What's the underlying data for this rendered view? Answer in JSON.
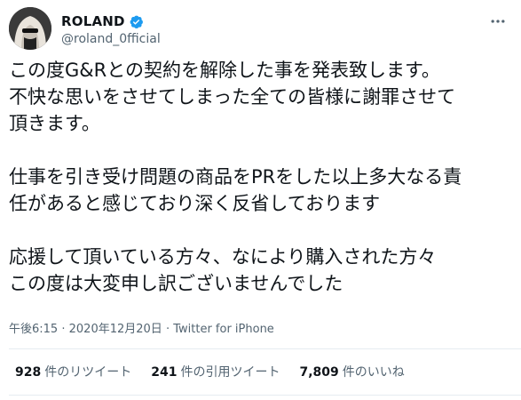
{
  "user": {
    "display_name": "ROLAND",
    "handle": "@roland_0fficial",
    "verified": true
  },
  "tweet": {
    "paragraphs": [
      [
        "この度G&Rとの契約を解除した事を発表致します。",
        "不快な思いをさせてしまった全ての皆様に謝罪させて",
        "頂きます。"
      ],
      [
        "仕事を引き受け問題の商品をPRをした以上多大なる責",
        "任があると感じており深く反省しております"
      ],
      [
        "応援して頂いている方々、なにより購入された方々",
        "この度は大変申し訳ございませんでした"
      ]
    ]
  },
  "meta": {
    "time": "午後6:15",
    "separator": "·",
    "date": "2020年12月20日",
    "source": "Twitter for iPhone"
  },
  "stats": {
    "retweets_count": "928",
    "retweets_label": "件のリツイート",
    "quotes_count": "241",
    "quotes_label": "件の引用ツイート",
    "likes_count": "7,809",
    "likes_label": "件のいいね"
  },
  "colors": {
    "verified": "#1d9bf0",
    "secondary_text": "#536471",
    "divider": "#e6ecf0"
  },
  "icons": {
    "verified": "verified-badge-icon",
    "more": "more-options-icon"
  }
}
